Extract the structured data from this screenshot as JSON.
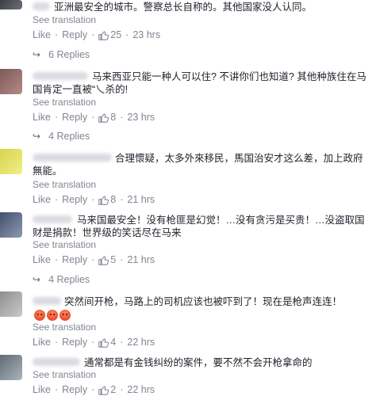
{
  "actions": {
    "like": "Like",
    "reply": "Reply",
    "separator": "·",
    "see_translation": "See translation"
  },
  "icons": {
    "like": "thumbs-up-icon",
    "replies": "reply-arrow-icon",
    "reaction": "angry-face-icon"
  },
  "colors": {
    "text": "#1d2129",
    "muted": "#7f8691",
    "link": "#7f8691"
  },
  "comments": [
    {
      "text": "亚洲最安全的城市。警察总长自称的。其他国家没人认同。",
      "like_count": "25",
      "time": "23 hrs",
      "replies_label": "6 Replies"
    },
    {
      "text": "马来西亚只能一种人可以住? 不讲你们也知道? 其他种族住在马国肯定一直被“乀杀的!",
      "like_count": "8",
      "time": "23 hrs",
      "replies_label": "4 Replies"
    },
    {
      "text": "合理懷疑，太多外來移民，馬国治安才这么差，加上政府無能。",
      "like_count": "8",
      "time": "21 hrs"
    },
    {
      "text": "马来国最安全！没有枪匪是幻觉！…没有贪污是买贵！…没盗取国财是捐款！世界级的笑话尽在马来",
      "like_count": "5",
      "time": "21 hrs",
      "replies_label": "4 Replies"
    },
    {
      "text": "突然间开枪，马路上的司机应该也被吓到了！现在是枪声连连！",
      "like_count": "4",
      "time": "22 hrs"
    },
    {
      "text": "通常都是有金钱纠纷的案件，要不然不会开枪拿命的",
      "like_count": "2",
      "time": "22 hrs"
    }
  ]
}
